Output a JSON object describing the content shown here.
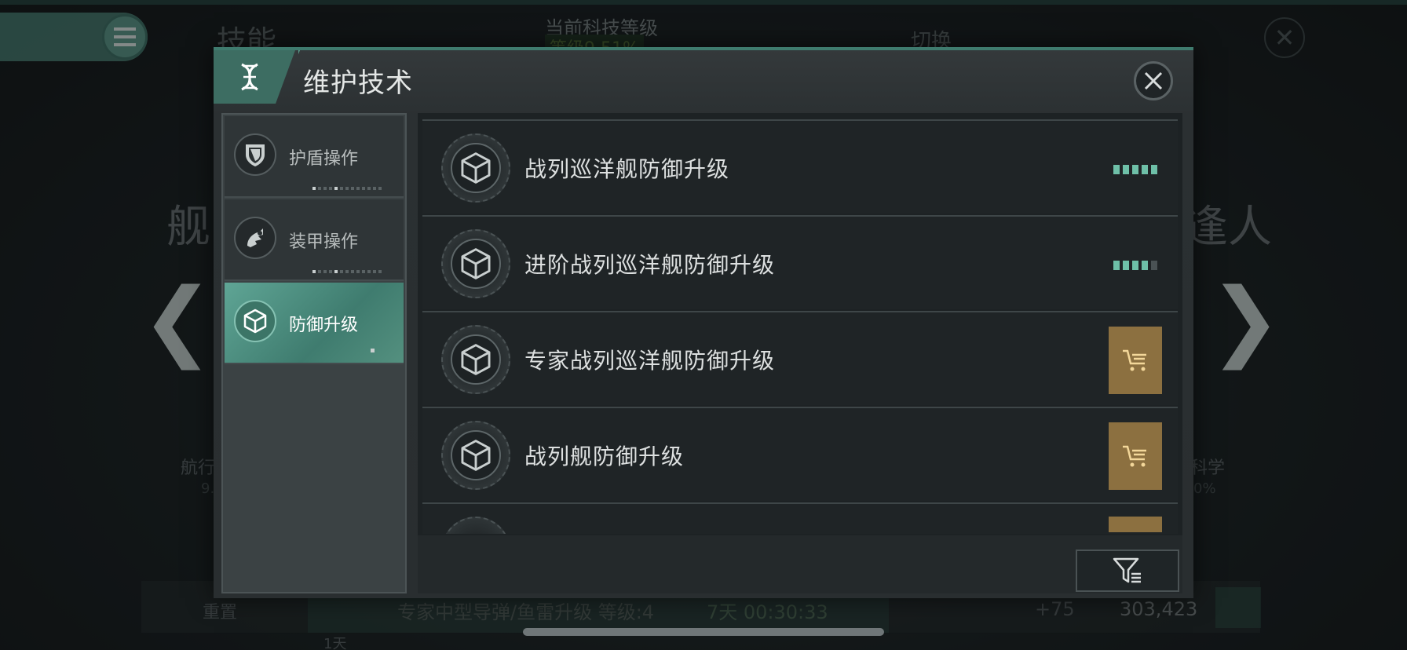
{
  "background": {
    "title": "技能",
    "tech_level_label": "当前科技等级",
    "tech_level_value": "等级9 51%",
    "switch_label": "切换",
    "left_char": "舰",
    "right_char": "逢人",
    "left_card_label": "航行",
    "left_card_sub": "9.",
    "right_card_label": "科学",
    "right_card_sub": "0%",
    "reset_label": "重置",
    "queue_text": "专家中型导弹/鱼雷升级 等级:4",
    "queue_time": "7天 00:30:33",
    "queue_day": "1天",
    "omega_bonus": "+75",
    "resource_value": "303,423",
    "prev_arrow": "❮",
    "next_arrow": "❯"
  },
  "dialog": {
    "title": "维护技术",
    "header_icon": "dna-icon",
    "close_icon": "close-icon"
  },
  "sidebar": {
    "items": [
      {
        "label": "护盾操作",
        "icon": "shield-icon",
        "active": false
      },
      {
        "label": "装甲操作",
        "icon": "armor-icon",
        "active": false
      },
      {
        "label": "防御升级",
        "icon": "cube-icon",
        "active": true
      }
    ]
  },
  "skills": [
    {
      "label": "战列巡洋舰防御升级",
      "icon": "cube-icon",
      "state": "progress",
      "level": 5,
      "max": 5
    },
    {
      "label": "进阶战列巡洋舰防御升级",
      "icon": "cube-icon",
      "state": "progress",
      "level": 4,
      "max": 5
    },
    {
      "label": "专家战列巡洋舰防御升级",
      "icon": "cube-icon",
      "state": "buy",
      "button_icon": "cart-icon"
    },
    {
      "label": "战列舰防御升级",
      "icon": "cube-icon",
      "state": "buy",
      "button_icon": "cart-icon"
    }
  ],
  "filter": {
    "icon": "filter-icon"
  },
  "colors": {
    "accent": "#3f7b6e",
    "progress_on": "#6ec0a8",
    "buy_button": "#8c7040"
  }
}
